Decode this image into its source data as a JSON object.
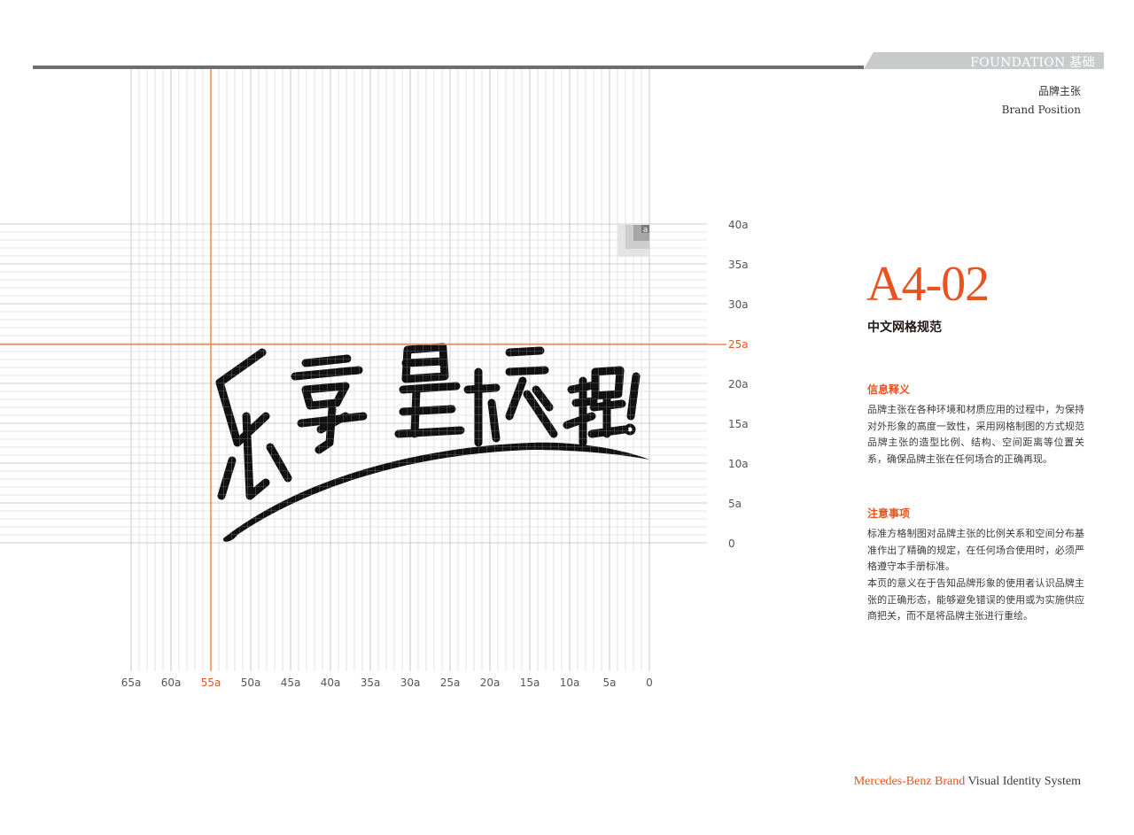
{
  "header": {
    "tab_label": "FOUNDATION 基础",
    "section_zh": "品牌主张",
    "section_en": "Brand Position"
  },
  "grid": {
    "x_ticks": [
      "65a",
      "60a",
      "55a",
      "50a",
      "45a",
      "40a",
      "35a",
      "30a",
      "25a",
      "20a",
      "15a",
      "10a",
      "5a",
      "0"
    ],
    "y_ticks": [
      "40a",
      "35a",
      "30a",
      "25a",
      "20a",
      "15a",
      "10a",
      "5a",
      "0"
    ],
    "x_highlight": "55a",
    "y_highlight": "25a",
    "unit_label": "a",
    "accent_color": "#e8531f",
    "slogan": "乐享星旅程!"
  },
  "content": {
    "code": "A4-02",
    "code_title": "中文网格规范",
    "section1_title": "信息释义",
    "section1_text": "品牌主张在各种环境和材质应用的过程中，为保持对外形象的高度一致性，采用网格制图的方式规范品牌主张的造型比例、结构、空间距离等位置关系，确保品牌主张在任何场合的正确再现。",
    "section2_title": "注意事项",
    "section2_text1": "标准方格制图对品牌主张的比例关系和空间分布基准作出了精确的规定，在任何场合使用时，必须严格遵守本手册标准。",
    "section2_text2": "本页的意义在于告知品牌形象的使用者认识品牌主张的正确形态，能够避免错误的使用或为实施供应商把关，而不是将品牌主张进行重绘。"
  },
  "footer": {
    "brand": "Mercedes-Benz Brand",
    "system": " Visual Identity System"
  }
}
